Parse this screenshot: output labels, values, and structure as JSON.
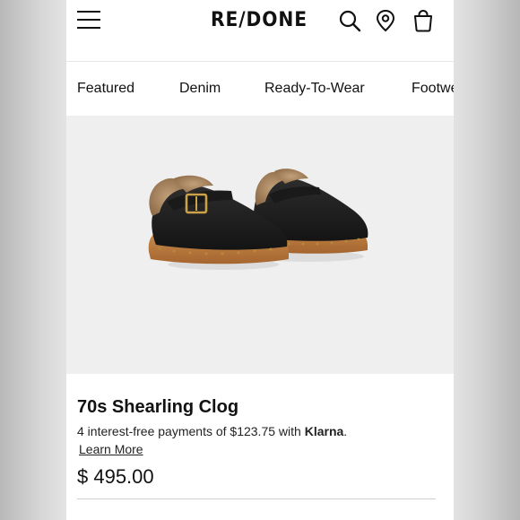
{
  "header": {
    "logo": "RE/DONE",
    "icons": [
      "menu-icon",
      "search-icon",
      "location-pin-icon",
      "shopping-bag-icon"
    ]
  },
  "categories": [
    "Featured",
    "Denim",
    "Ready-To-Wear",
    "Footwear"
  ],
  "product": {
    "title": "70s Shearling Clog",
    "payment_prefix": "4 interest-free payments of $123.75 with ",
    "payment_brand": "Klarna",
    "payment_suffix": ".",
    "learn_more": "Learn More",
    "price": "$ 495.00",
    "image_alt": "product-image-black-shearling-clogs"
  },
  "colors": {
    "text": "#111111",
    "hero_background": "#efefef",
    "clog_leather": "#1c1c1c",
    "clog_wood": "#b8773d",
    "shearling": "#a58461"
  }
}
